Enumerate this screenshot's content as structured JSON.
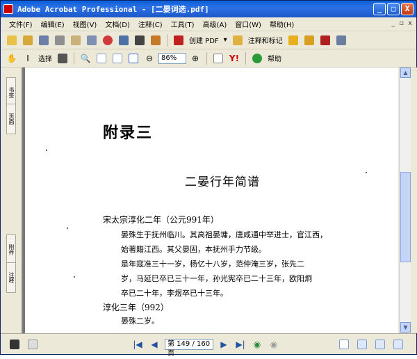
{
  "window": {
    "title": "Adobe Acrobat Professional - [二晏词选.pdf]",
    "controls": [
      "_",
      "□",
      "X"
    ]
  },
  "menu": [
    {
      "label": "文件(F)"
    },
    {
      "label": "编辑(E)"
    },
    {
      "label": "视图(V)"
    },
    {
      "label": "文档(D)"
    },
    {
      "label": "注释(C)"
    },
    {
      "label": "工具(T)"
    },
    {
      "label": "高级(A)"
    },
    {
      "label": "窗口(W)"
    },
    {
      "label": "帮助(H)"
    }
  ],
  "toolbar1": {
    "create_pdf": "创建 PDF",
    "comment": "注释和标记"
  },
  "toolbar2": {
    "select": "选择",
    "zoom": "86%",
    "help": "帮助"
  },
  "sidebar": {
    "tab1": "书签",
    "tab2": "页面",
    "tab3": "附件",
    "tab4": "注释"
  },
  "page": {
    "appendix_title": "附录三",
    "chronicle_title": "二晏行年简谱",
    "section1": "宋太宗淳化二年（公元991年）",
    "section1_lines": [
      "晏殊生于抚州临川。其高祖晏墉，唐咸通中举进士，官江西，",
      "始著籍江西。其父晏固，本抚州手力节级。",
      "是年寇准三十一岁，杨亿十八岁，范仲淹三岁，张先二",
      "岁，马延巳卒已三十一年，孙光宪卒已二十三年，欧阳炯",
      "卒已二十年，李煜卒已十三年。"
    ],
    "section2": "淳化三年（992）",
    "section2_lines": [
      "晏殊二岁。"
    ]
  },
  "status": {
    "page_indicator": "第 149 / 160 页"
  }
}
